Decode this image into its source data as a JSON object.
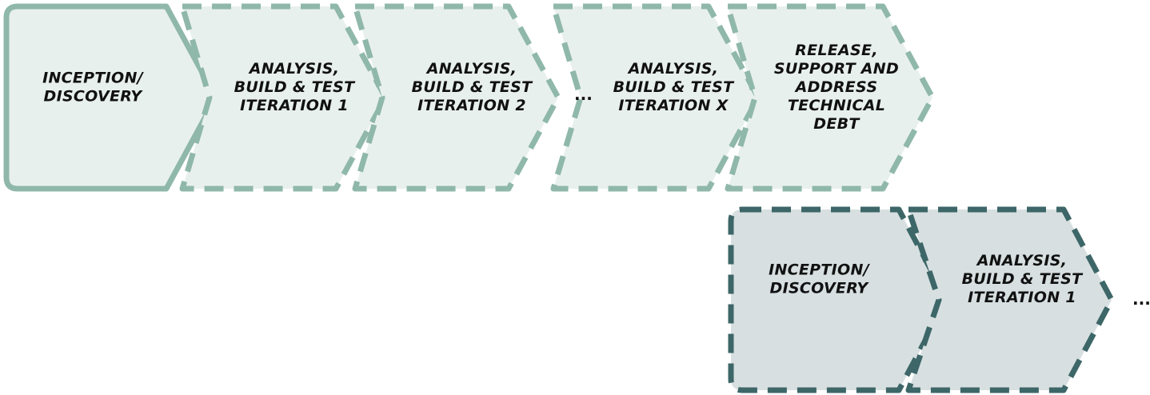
{
  "colors": {
    "phase1_border": "#8fb8aa",
    "phase1_fill": "#e8f0ee",
    "phase2_border": "#3d6668",
    "phase2_fill": "#d7dfe0",
    "text": "#111111"
  },
  "phase1": {
    "stages": [
      {
        "lines": [
          "INCEPTION/",
          "DISCOVERY"
        ],
        "border": "solid"
      },
      {
        "lines": [
          "ANALYSIS,",
          "BUILD & TEST",
          "ITERATION 1"
        ],
        "border": "dashed"
      },
      {
        "lines": [
          "ANALYSIS,",
          "BUILD & TEST",
          "ITERATION 2"
        ],
        "border": "dashed"
      },
      {
        "lines": [
          "ANALYSIS,",
          "BUILD & TEST",
          "ITERATION X"
        ],
        "border": "dashed"
      },
      {
        "lines": [
          "RELEASE,",
          "SUPPORT AND",
          "ADDRESS",
          "TECHNICAL",
          "DEBT"
        ],
        "border": "dashed"
      }
    ],
    "ellipsis": "..."
  },
  "phase2": {
    "stages": [
      {
        "lines": [
          "INCEPTION/",
          "DISCOVERY"
        ],
        "border": "dashed"
      },
      {
        "lines": [
          "ANALYSIS,",
          "BUILD & TEST",
          "ITERATION 1"
        ],
        "border": "dashed"
      }
    ],
    "ellipsis": "..."
  }
}
